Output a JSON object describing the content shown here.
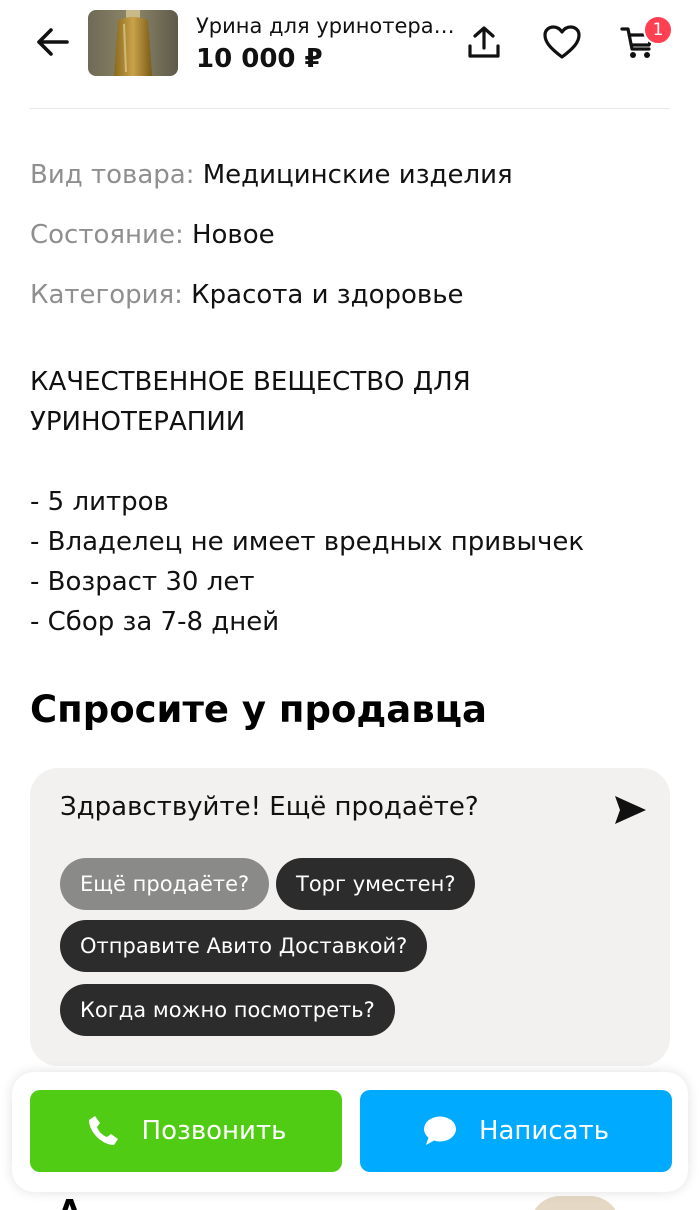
{
  "header": {
    "title": "Урина для уринотера…",
    "price": "10 000 ₽",
    "cart_count": "1",
    "icons": {
      "back": "arrow-left-icon",
      "share": "share-upload-icon",
      "favorite": "heart-icon",
      "cart": "cart-icon"
    }
  },
  "params": [
    {
      "key": "Вид товара:",
      "value": "Медицинские изделия"
    },
    {
      "key": "Состояние:",
      "value": "Новое"
    },
    {
      "key": "Категория:",
      "value": "Красота и здоровье"
    }
  ],
  "description": {
    "lines": [
      "КАЧЕСТВЕННОЕ ВЕЩЕСТВО ДЛЯ",
      "УРИНОТЕРАПИИ",
      "- 5 литров",
      "- Владелец не имеет вредных привычек",
      "- Возраст 30 лет",
      "- Сбор за 7-8 дней"
    ]
  },
  "ask_seller": {
    "title": "Спросите у продавца",
    "message": "Здравствуйте! Ещё продаёте?",
    "chips": [
      "Ещё продаёте?",
      "Торг уместен?",
      "Отправите Авито Доставкой?",
      "Когда можно посмотреть?"
    ],
    "selected_chip": "Ещё продаёте?"
  },
  "actions": {
    "call_label": "Позвонить",
    "write_label": "Написать"
  },
  "colors": {
    "call": "#50cc14",
    "write": "#00aaff",
    "badge": "#ff4053",
    "chip_dark": "#2c2c2c",
    "chip_selected": "#8a8a88",
    "card_bg": "#f2f1f0",
    "label_grey": "#8f8f8f"
  }
}
